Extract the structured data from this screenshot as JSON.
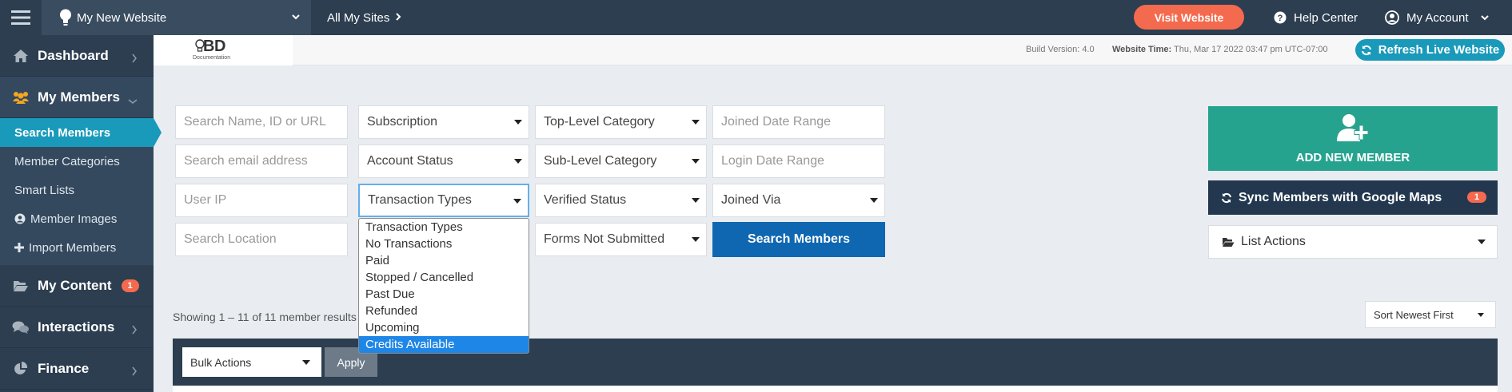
{
  "topbar": {
    "site_name": "My New Website",
    "all_sites": "All My Sites",
    "visit_website": "Visit Website",
    "help_center": "Help Center",
    "my_account": "My Account"
  },
  "sidebar": {
    "dashboard": "Dashboard",
    "my_members": "My Members",
    "sub_items": [
      "Search Members",
      "Member Categories",
      "Smart Lists",
      "Member Images",
      "Import Members"
    ],
    "my_content": "My Content",
    "my_content_badge": "1",
    "interactions": "Interactions",
    "finance": "Finance"
  },
  "subheader": {
    "logo_text": "BD",
    "logo_sub": "Documentation",
    "build_version": "Build Version: 4.0",
    "website_time_label": "Website Time:",
    "website_time_value": "Thu, Mar 17 2022 03:47 pm UTC-07:00",
    "refresh_live": "Refresh Live Website"
  },
  "filters": {
    "search_name_placeholder": "Search Name, ID or URL",
    "search_email_placeholder": "Search email address",
    "user_ip_placeholder": "User IP",
    "search_location_placeholder": "Search Location",
    "subscription": "Subscription",
    "account_status": "Account Status",
    "transaction_types": "Transaction Types",
    "top_level_category": "Top-Level Category",
    "sub_level_category": "Sub-Level Category",
    "verified_status": "Verified Status",
    "forms_not_submitted": "Forms Not Submitted",
    "joined_date_range_placeholder": "Joined Date Range",
    "login_date_range_placeholder": "Login Date Range",
    "joined_via": "Joined Via",
    "search_members_btn": "Search Members"
  },
  "transaction_dropdown": {
    "options": [
      "Transaction Types",
      "No Transactions",
      "Paid",
      "Stopped / Cancelled",
      "Past Due",
      "Refunded",
      "Upcoming",
      "Credits Available"
    ],
    "highlighted": "Credits Available"
  },
  "actions": {
    "add_new_member": "ADD NEW MEMBER",
    "sync_google_maps": "Sync Members with Google Maps",
    "sync_badge": "1",
    "list_actions": "List Actions"
  },
  "results": {
    "showing": "Showing 1 – 11 of 11 member results",
    "sort": "Sort Newest First",
    "bulk_actions": "Bulk Actions",
    "apply": "Apply"
  }
}
